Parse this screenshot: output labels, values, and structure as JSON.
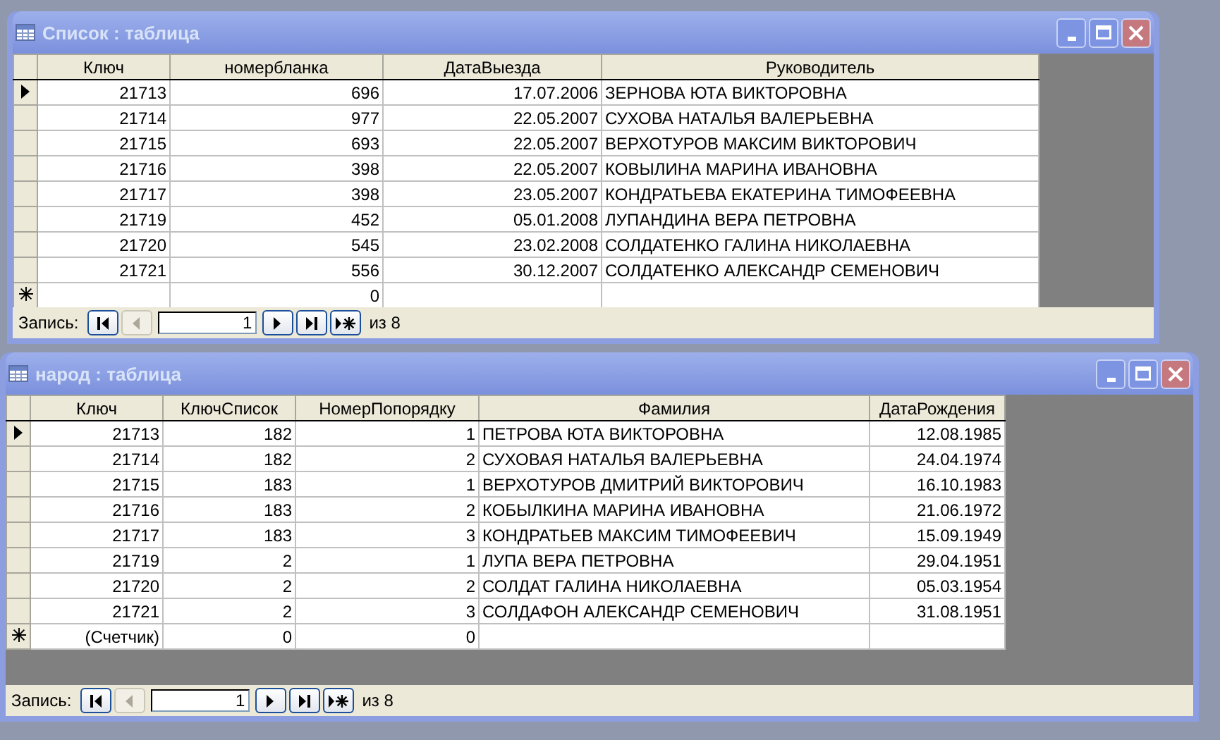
{
  "windows": [
    {
      "title": "Список : таблица",
      "active": false,
      "columns": [
        {
          "label": "Ключ"
        },
        {
          "label": "номербланка"
        },
        {
          "label": "ДатаВыезда"
        },
        {
          "label": "Руководитель"
        }
      ],
      "rows": [
        {
          "kind": "record",
          "current": true,
          "cells": [
            "21713",
            "696",
            "17.07.2006",
            "ЗЕРНОВА ЮТА ВИКТОРОВНА"
          ]
        },
        {
          "kind": "record",
          "current": false,
          "cells": [
            "21714",
            "977",
            "22.05.2007",
            "СУХОВА НАТАЛЬЯ ВАЛЕРЬЕВНА"
          ]
        },
        {
          "kind": "record",
          "current": false,
          "cells": [
            "21715",
            "693",
            "22.05.2007",
            "ВЕРХОТУРОВ МАКСИМ ВИКТОРОВИЧ"
          ]
        },
        {
          "kind": "record",
          "current": false,
          "cells": [
            "21716",
            "398",
            "22.05.2007",
            "КОВЫЛИНА МАРИНА ИВАНОВНА"
          ]
        },
        {
          "kind": "record",
          "current": false,
          "cells": [
            "21717",
            "398",
            "23.05.2007",
            "КОНДРАТЬЕВА ЕКАТЕРИНА ТИМОФЕЕВНА"
          ]
        },
        {
          "kind": "record",
          "current": false,
          "cells": [
            "21719",
            "452",
            "05.01.2008",
            "ЛУПАНДИНА ВЕРА ПЕТРОВНА"
          ]
        },
        {
          "kind": "record",
          "current": false,
          "cells": [
            "21720",
            "545",
            "23.02.2008",
            "СОЛДАТЕНКО ГАЛИНА НИКОЛАЕВНА"
          ]
        },
        {
          "kind": "record",
          "current": false,
          "cells": [
            "21721",
            "556",
            "30.12.2007",
            "СОЛДАТЕНКО АЛЕКСАНДР СЕМЕНОВИЧ"
          ]
        },
        {
          "kind": "new",
          "current": false,
          "cells": [
            null,
            "0",
            null,
            null
          ]
        }
      ],
      "navigation": {
        "label": "Запись:",
        "record": "1",
        "total": "из 8",
        "buttons": [
          {
            "kind": "first",
            "disabled": false
          },
          {
            "kind": "previous",
            "disabled": true
          },
          {
            "kind": "next",
            "disabled": false
          },
          {
            "kind": "last",
            "disabled": false
          },
          {
            "kind": "new",
            "disabled": false
          }
        ]
      }
    },
    {
      "title": "народ : таблица",
      "active": false,
      "columns": [
        {
          "label": "Ключ"
        },
        {
          "label": "КлючСписок"
        },
        {
          "label": "НомерПопорядку"
        },
        {
          "label": "Фамилия"
        },
        {
          "label": "ДатаРождения"
        }
      ],
      "rows": [
        {
          "kind": "record",
          "current": true,
          "cells": [
            "21713",
            "182",
            "1",
            "ПЕТРОВА ЮТА ВИКТОРОВНА",
            "12.08.1985"
          ]
        },
        {
          "kind": "record",
          "current": false,
          "cells": [
            "21714",
            "182",
            "2",
            "СУХОВАЯ НАТАЛЬЯ ВАЛЕРЬЕВНА",
            "24.04.1974"
          ]
        },
        {
          "kind": "record",
          "current": false,
          "cells": [
            "21715",
            "183",
            "1",
            "ВЕРХОТУРОВ ДМИТРИЙ ВИКТОРОВИЧ",
            "16.10.1983"
          ]
        },
        {
          "kind": "record",
          "current": false,
          "cells": [
            "21716",
            "183",
            "2",
            "КОБЫЛКИНА МАРИНА ИВАНОВНА",
            "21.06.1972"
          ]
        },
        {
          "kind": "record",
          "current": false,
          "cells": [
            "21717",
            "183",
            "3",
            "КОНДРАТЬЕВ МАКСИМ ТИМОФЕЕВИЧ",
            "15.09.1949"
          ]
        },
        {
          "kind": "record",
          "current": false,
          "cells": [
            "21719",
            "2",
            "1",
            "ЛУПА ВЕРА ПЕТРОВНА",
            "29.04.1951"
          ]
        },
        {
          "kind": "record",
          "current": false,
          "cells": [
            "21720",
            "2",
            "2",
            "СОЛДАТ ГАЛИНА НИКОЛАЕВНА",
            "05.03.1954"
          ]
        },
        {
          "kind": "record",
          "current": false,
          "cells": [
            "21721",
            "2",
            "3",
            "СОЛДАФОН АЛЕКСАНДР СЕМЕНОВИЧ",
            "31.08.1951"
          ]
        },
        {
          "kind": "new",
          "current": false,
          "cells": [
            "(Счетчик)",
            "0",
            "0",
            null,
            null
          ]
        }
      ],
      "navigation": {
        "label": "Запись:",
        "record": "1",
        "total": "из 8",
        "buttons": [
          {
            "kind": "first",
            "disabled": false
          },
          {
            "kind": "previous",
            "disabled": true
          },
          {
            "kind": "next",
            "disabled": false
          },
          {
            "kind": "last",
            "disabled": false
          },
          {
            "kind": "new",
            "disabled": false
          }
        ]
      }
    }
  ]
}
